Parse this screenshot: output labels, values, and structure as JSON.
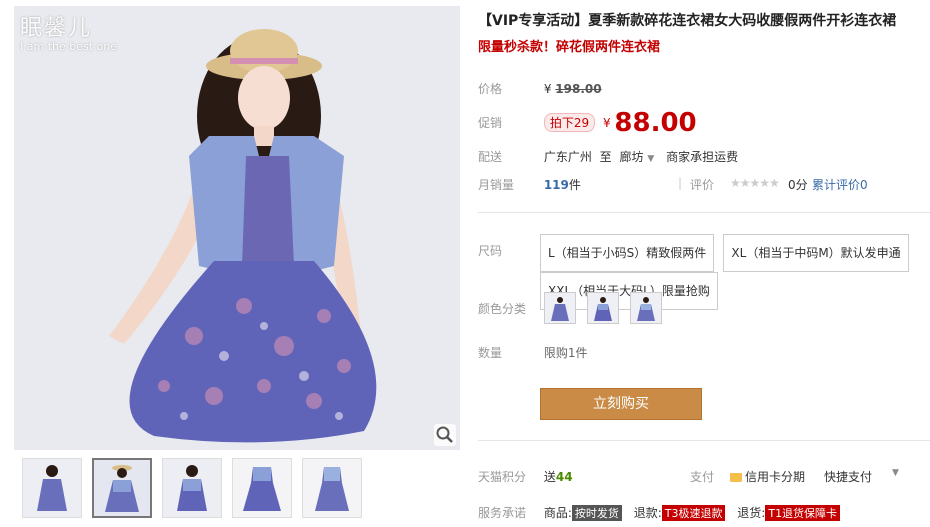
{
  "brand": {
    "name_cn": "眠馨儿",
    "tagline": "I am the best one"
  },
  "product": {
    "title": "【VIP专享活动】夏季新款碎花连衣裙女大码收腰假两件开衫连衣裙",
    "subtitle": "限量秒杀款！碎花假两件连衣裙"
  },
  "price": {
    "label": "价格",
    "currency": "¥",
    "original": "198.00"
  },
  "promo": {
    "label": "促销",
    "tag": "拍下29",
    "currency": "¥",
    "price": "88.00"
  },
  "delivery": {
    "label": "配送",
    "from": "广东广州",
    "to_word": "至",
    "to": "廊坊",
    "shipping": "商家承担运费"
  },
  "sales": {
    "label": "月销量",
    "count": "119",
    "unit": "件",
    "rating_label": "评价",
    "rating_score": "0分",
    "reviews": "累计评价0"
  },
  "size": {
    "label": "尺码",
    "options": [
      "L（相当于小码S）精致假两件",
      "XL（相当于中码M）默认发申通",
      "XXL（相当于大码L）限量抢购"
    ]
  },
  "color": {
    "label": "颜色分类"
  },
  "quantity": {
    "label": "数量",
    "limit": "限购1件"
  },
  "buy": {
    "label": "立刻购买"
  },
  "points": {
    "label": "天猫积分",
    "send": "送",
    "value": "44",
    "pay_label": "支付",
    "credit": "信用卡分期",
    "quick": "快捷支付"
  },
  "service": {
    "label": "服务承诺",
    "goods": "商品:",
    "goods_badge": "按时发货",
    "refund": "退款:",
    "refund_badge": "T3极速退款",
    "return": "退货:",
    "return_badge": "T1退货保障卡"
  }
}
